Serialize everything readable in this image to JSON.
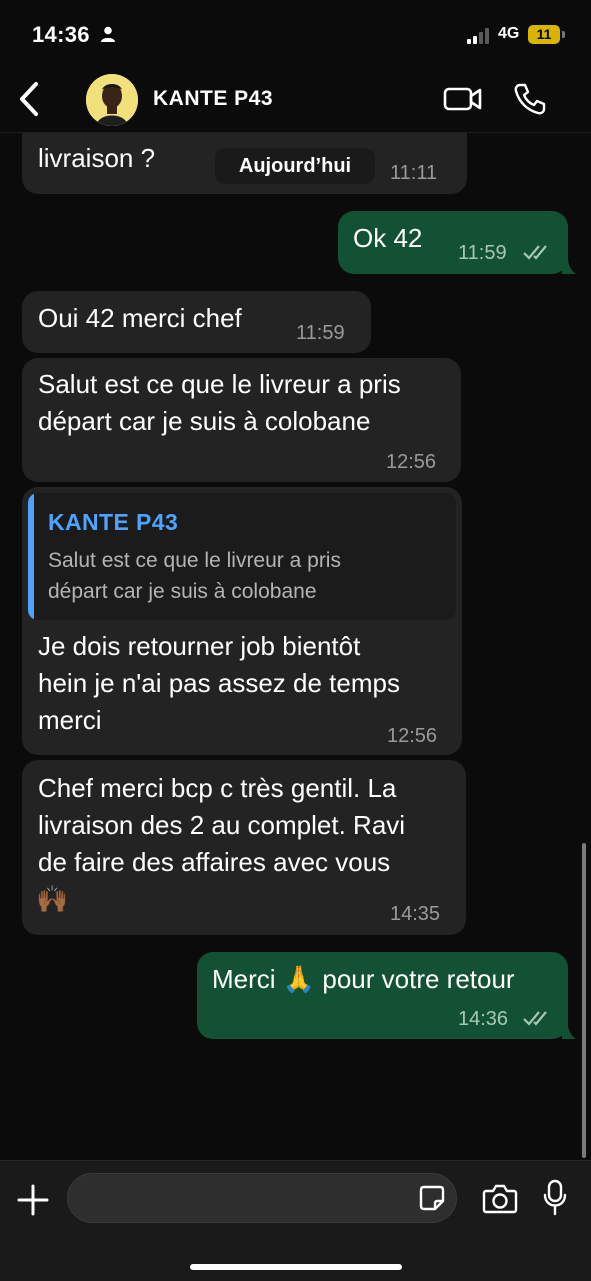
{
  "status_bar": {
    "time": "14:36",
    "network": "4G",
    "battery": "11"
  },
  "header": {
    "contact_name": "KANTE P43"
  },
  "date_chip": "Aujourd’hui",
  "messages": [
    {
      "direction": "incoming",
      "text": "livraison ?",
      "time": "11:11"
    },
    {
      "direction": "outgoing",
      "text": "Ok 42",
      "time": "11:59",
      "status": "read"
    },
    {
      "direction": "incoming",
      "text": "Oui 42 merci chef",
      "time": "11:59"
    },
    {
      "direction": "incoming",
      "lines": [
        "Salut est ce que le livreur a pris",
        "départ car je suis à colobane"
      ],
      "time": "12:56"
    },
    {
      "direction": "incoming",
      "reply_to": {
        "name": "KANTE P43",
        "lines": [
          "Salut est ce que le livreur a pris",
          "départ car je suis à colobane"
        ]
      },
      "lines": [
        "Je dois retourner job bientôt",
        "hein je n'ai pas assez de temps",
        "merci"
      ],
      "time": "12:56"
    },
    {
      "direction": "incoming",
      "lines": [
        "Chef merci bcp c très gentil. La",
        "livraison des 2 au complet. Ravi",
        "de faire des affaires avec vous",
        "🙌🏾"
      ],
      "time": "14:35"
    },
    {
      "direction": "outgoing",
      "text": "Merci 🙏 pour votre retour",
      "time": "14:36",
      "status": "read"
    }
  ],
  "icons": {
    "back": "chevron-left-icon",
    "video": "video-camera-icon",
    "phone": "phone-icon",
    "plus": "plus-icon",
    "sticker": "sticker-icon",
    "camera": "camera-icon",
    "mic": "microphone-icon",
    "read_receipt": "double-check-icon"
  },
  "colors": {
    "incoming_bubble": "#232323",
    "outgoing_bubble": "#125134",
    "quote_accent": "#4ea3ff",
    "battery": "#d9b400"
  }
}
